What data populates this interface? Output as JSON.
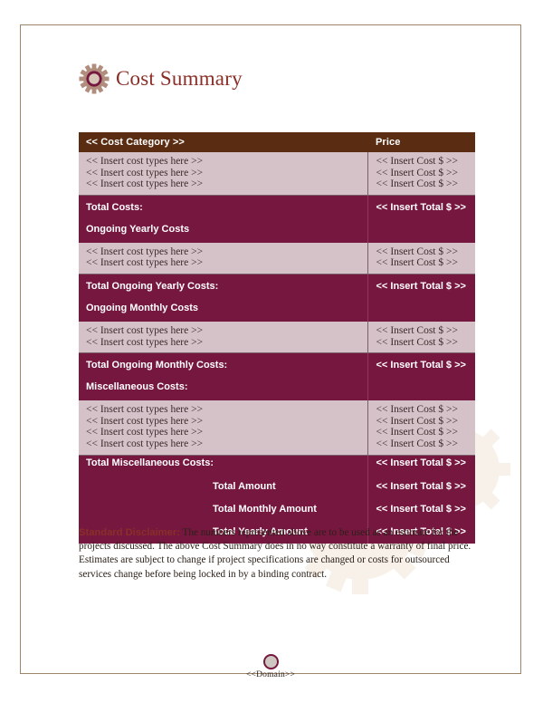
{
  "header": {
    "title": "Cost Summary",
    "icon": "gear-icon"
  },
  "table": {
    "columns": {
      "category": "<< Cost Category >>",
      "price": "Price"
    },
    "placeholders": {
      "cost_type": "<< Insert cost types here >>",
      "cost_value": "<< Insert Cost $ >>",
      "total_value": "<< Insert Total $ >>"
    },
    "sections": [
      {
        "id": "initial-costs",
        "rows": 3,
        "cost_types": [
          "<< Insert cost types here >>",
          "<< Insert cost types here >>",
          "<< Insert cost types here >>"
        ],
        "costs": [
          "<< Insert Cost $ >>",
          "<< Insert Cost $ >>",
          "<< Insert Cost $ >>"
        ]
      },
      {
        "id": "ongoing-yearly",
        "rows": 2,
        "cost_types": [
          "<< Insert cost types here >>",
          "<< Insert cost types here >>"
        ],
        "costs": [
          "<< Insert Cost $ >>",
          "<< Insert Cost $ >>"
        ]
      },
      {
        "id": "ongoing-monthly",
        "rows": 2,
        "cost_types": [
          "<< Insert cost types here >>",
          "<< Insert cost types here >>"
        ],
        "costs": [
          "<< Insert Cost $ >>",
          "<< Insert Cost $ >>"
        ]
      },
      {
        "id": "miscellaneous",
        "rows": 4,
        "cost_types": [
          "<< Insert cost types here >>",
          "<< Insert cost types here >>",
          "<< Insert cost types here >>",
          "<< Insert cost types here >>"
        ],
        "costs": [
          "<< Insert Cost $ >>",
          "<< Insert Cost $ >>",
          "<< Insert Cost $ >>",
          "<< Insert Cost $ >>"
        ]
      }
    ],
    "totals": {
      "total_costs_label": "Total Costs:",
      "total_costs_value": "<< Insert Total $ >>",
      "ongoing_yearly_heading": "Ongoing Yearly Costs",
      "total_ongoing_yearly_label": "Total Ongoing Yearly Costs:",
      "total_ongoing_yearly_value": "<< Insert Total $ >>",
      "ongoing_monthly_heading": "Ongoing Monthly Costs",
      "total_ongoing_monthly_label": "Total Ongoing Monthly Costs:",
      "total_ongoing_monthly_value": "<< Insert Total $ >>",
      "miscellaneous_heading": "Miscellaneous Costs:",
      "total_miscellaneous_label": "Total Miscellaneous Costs:",
      "total_miscellaneous_value": "<< Insert Total $ >>",
      "total_amount_label": "Total Amount",
      "total_amount_value": "<< Insert Total $ >>",
      "total_monthly_label": "Total Monthly Amount",
      "total_monthly_value": "<< Insert Total $ >>",
      "total_yearly_label": "Total Yearly Amount",
      "total_yearly_value": "<< Insert Total $ >>"
    }
  },
  "disclaimer": {
    "lead": "Standard Disclaimer:",
    "body": " The numbers represented above are to be used as an estimate for the projects discussed. The above Cost Summary does in no way constitute a warranty of final price. Estimates are subject to change if project specifications are changed or costs for outsourced services change before being locked in by a binding contract."
  },
  "footer": {
    "domain": "<<Domain>>",
    "icon": "circle-icon"
  },
  "colors": {
    "header_brown": "#5a2d12",
    "maroon": "#76173f",
    "light_row": "#d5c2c9",
    "title_red": "#8a2f28",
    "page_border": "#9c8568"
  }
}
